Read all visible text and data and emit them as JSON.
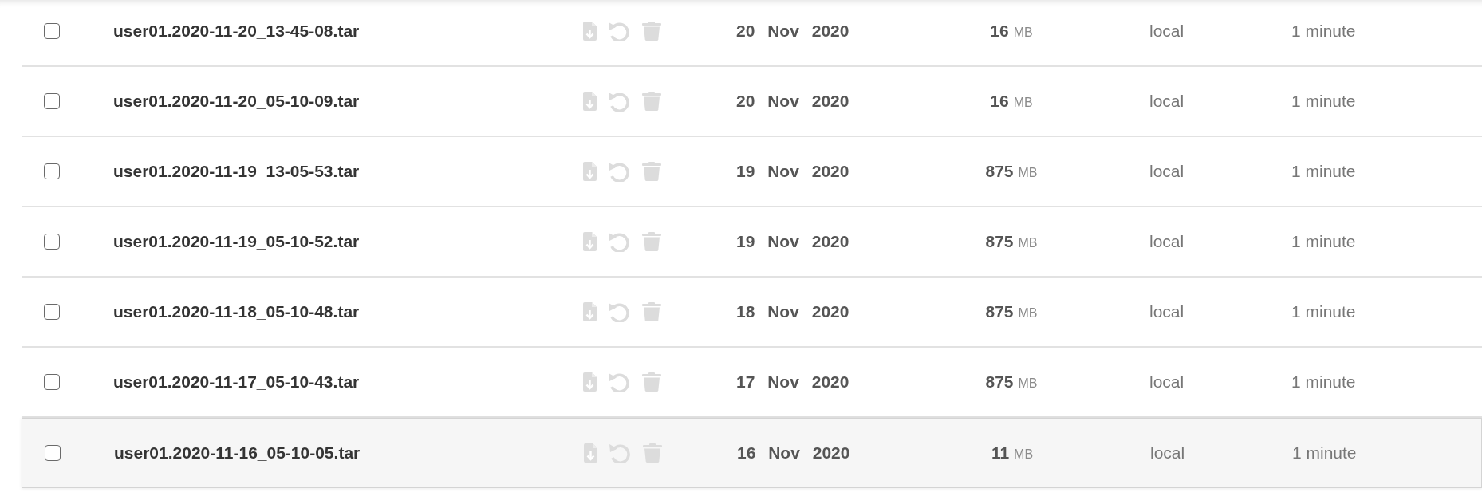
{
  "backups": [
    {
      "checked": false,
      "name": "user01.2020-11-20_13-45-08.tar",
      "date": "20 Nov 2020",
      "size": "16",
      "unit": "MB",
      "location": "local",
      "duration": "1 minute",
      "highlighted": false
    },
    {
      "checked": false,
      "name": "user01.2020-11-20_05-10-09.tar",
      "date": "20 Nov 2020",
      "size": "16",
      "unit": "MB",
      "location": "local",
      "duration": "1 minute",
      "highlighted": false
    },
    {
      "checked": false,
      "name": "user01.2020-11-19_13-05-53.tar",
      "date": "19 Nov 2020",
      "size": "875",
      "unit": "MB",
      "location": "local",
      "duration": "1 minute",
      "highlighted": false
    },
    {
      "checked": false,
      "name": "user01.2020-11-19_05-10-52.tar",
      "date": "19 Nov 2020",
      "size": "875",
      "unit": "MB",
      "location": "local",
      "duration": "1 minute",
      "highlighted": false
    },
    {
      "checked": false,
      "name": "user01.2020-11-18_05-10-48.tar",
      "date": "18 Nov 2020",
      "size": "875",
      "unit": "MB",
      "location": "local",
      "duration": "1 minute",
      "highlighted": false
    },
    {
      "checked": false,
      "name": "user01.2020-11-17_05-10-43.tar",
      "date": "17 Nov 2020",
      "size": "875",
      "unit": "MB",
      "location": "local",
      "duration": "1 minute",
      "highlighted": false
    },
    {
      "checked": false,
      "name": "user01.2020-11-16_05-10-05.tar",
      "date": "16 Nov 2020",
      "size": "11",
      "unit": "MB",
      "location": "local",
      "duration": "1 minute",
      "highlighted": true
    }
  ]
}
